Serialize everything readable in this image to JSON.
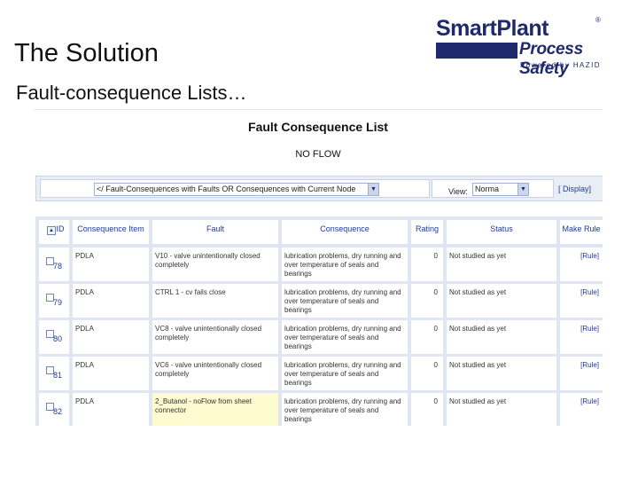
{
  "slide": {
    "title": "The Solution",
    "subtitle": "Fault-consequence Lists…"
  },
  "logo": {
    "name": "SmartPlant",
    "registered": "®",
    "product": "Process Safety",
    "powered": "Powered by HAZID"
  },
  "list": {
    "title": "Fault Consequence List",
    "node_name": "NO FLOW"
  },
  "filter": {
    "query_value": "</ Fault-Consequences with Faults OR Consequences with Current Node",
    "view_label": "View:",
    "view_value": "Norma",
    "display_link": "[ Display]"
  },
  "table": {
    "headers": [
      "ID",
      "Consequence Item",
      "Fault",
      "Consequence",
      "Rating",
      "Status",
      "Make Rule"
    ],
    "rows": [
      {
        "id": "78",
        "item": "PDLA",
        "fault": "V10 - valve unintentionally closed completely",
        "consequence": "lubrication problems, dry running and over temperature of seals and bearings",
        "rating": "0",
        "status": "Not studied as yet",
        "rule": "[Rule]",
        "yellow": false
      },
      {
        "id": "79",
        "item": "PDLA",
        "fault": "CTRL 1 - cv fails close",
        "consequence": "lubrication problems, dry running and over temperature of seals and bearings",
        "rating": "0",
        "status": "Not studied as yet",
        "rule": "[Rule]",
        "yellow": false
      },
      {
        "id": "80",
        "item": "PDLA",
        "fault": "VC8 - valve unintentionally closed completely",
        "consequence": "lubrication problems, dry running and over temperature of seals and bearings",
        "rating": "0",
        "status": "Not studied as yet",
        "rule": "[Rule]",
        "yellow": false
      },
      {
        "id": "81",
        "item": "PDLA",
        "fault": "VC6 - valve unintentionally closed completely",
        "consequence": "lubrication problems, dry running and over temperature of seals and bearings",
        "rating": "0",
        "status": "Not studied as yet",
        "rule": "[Rule]",
        "yellow": false
      },
      {
        "id": "82",
        "item": "PDLA",
        "fault": "2_Butanol - noFlow from sheet connector",
        "consequence": "lubrication problems, dry running and over temperature of seals and bearings",
        "rating": "0",
        "status": "Not studied as yet",
        "rule": "[Rule]",
        "yellow": true
      }
    ]
  },
  "colors": {
    "brand": "#1e2a6b",
    "link": "#1e3a9a",
    "highlight": "#fefbd0"
  }
}
